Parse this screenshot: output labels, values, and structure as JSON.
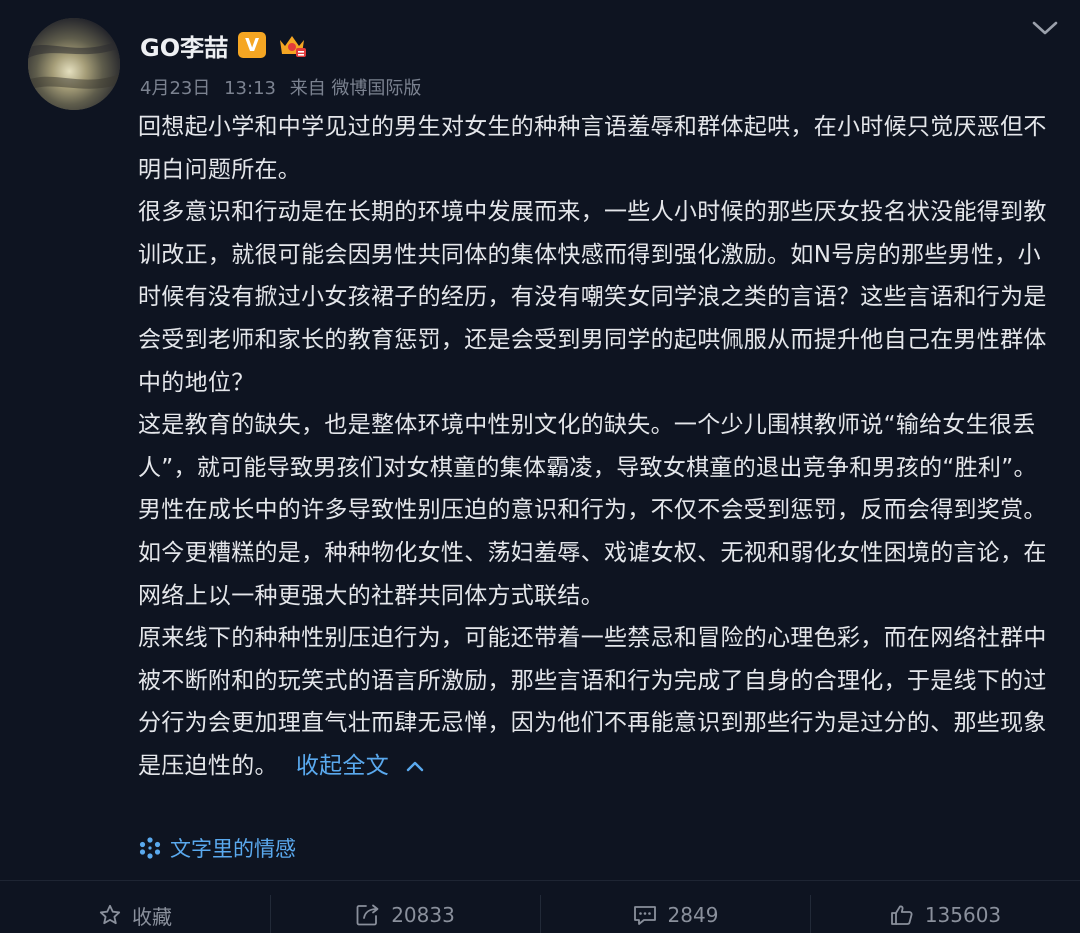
{
  "post": {
    "username": "GO李喆",
    "badges": {
      "verified": "V"
    },
    "meta": {
      "date": "4月23日",
      "time": "13:13",
      "source": "来自 微博国际版"
    },
    "paragraphs": [
      "回想起小学和中学见过的男生对女生的种种言语羞辱和群体起哄，在小时候只觉厌恶但不明白问题所在。",
      "很多意识和行动是在长期的环境中发展而来，一些人小时候的那些厌女投名状没能得到教训改正，就很可能会因男性共同体的集体快感而得到强化激励。如N号房的那些男性，小时候有没有掀过小女孩裙子的经历，有没有嘲笑女同学浪之类的言语？这些言语和行为是会受到老师和家长的教育惩罚，还是会受到男同学的起哄佩服从而提升他自己在男性群体中的地位？",
      "这是教育的缺失，也是整体环境中性别文化的缺失。一个少儿围棋教师说“输给女生很丢人”，就可能导致男孩们对女棋童的集体霸凌，导致女棋童的退出竞争和男孩的“胜利”。男性在成长中的许多导致性别压迫的意识和行为，不仅不会受到惩罚，反而会得到奖赏。",
      "如今更糟糕的是，种种物化女性、荡妇羞辱、戏谑女权、无视和弱化女性困境的言论，在网络上以一种更强大的社群共同体方式联结。",
      "原来线下的种种性别压迫行为，可能还带着一些禁忌和冒险的心理色彩，而在网络社群中被不断附和的玩笑式的语言所激励，那些言语和行为完成了自身的合理化，于是线下的过分行为会更加理直气壮而肆无忌惮，因为他们不再能意识到那些行为是过分的、那些现象是压迫性的。"
    ],
    "collapse_label": "收起全文",
    "topic_label": "文字里的情感"
  },
  "actions": {
    "favorite": "收藏",
    "repost": "20833",
    "comment": "2849",
    "like": "135603"
  },
  "icons": {
    "chevron": "chevron-down-icon",
    "topic": "sparkle-icon",
    "favorite": "star-icon",
    "repost": "repost-icon",
    "comment": "comment-icon",
    "like": "thumbs-up-icon"
  },
  "colors": {
    "background": "#0e1421",
    "text": "#e4e6ea",
    "meta": "#7b8290",
    "link": "#5aa9ee",
    "verified_badge": "#f5a623"
  }
}
